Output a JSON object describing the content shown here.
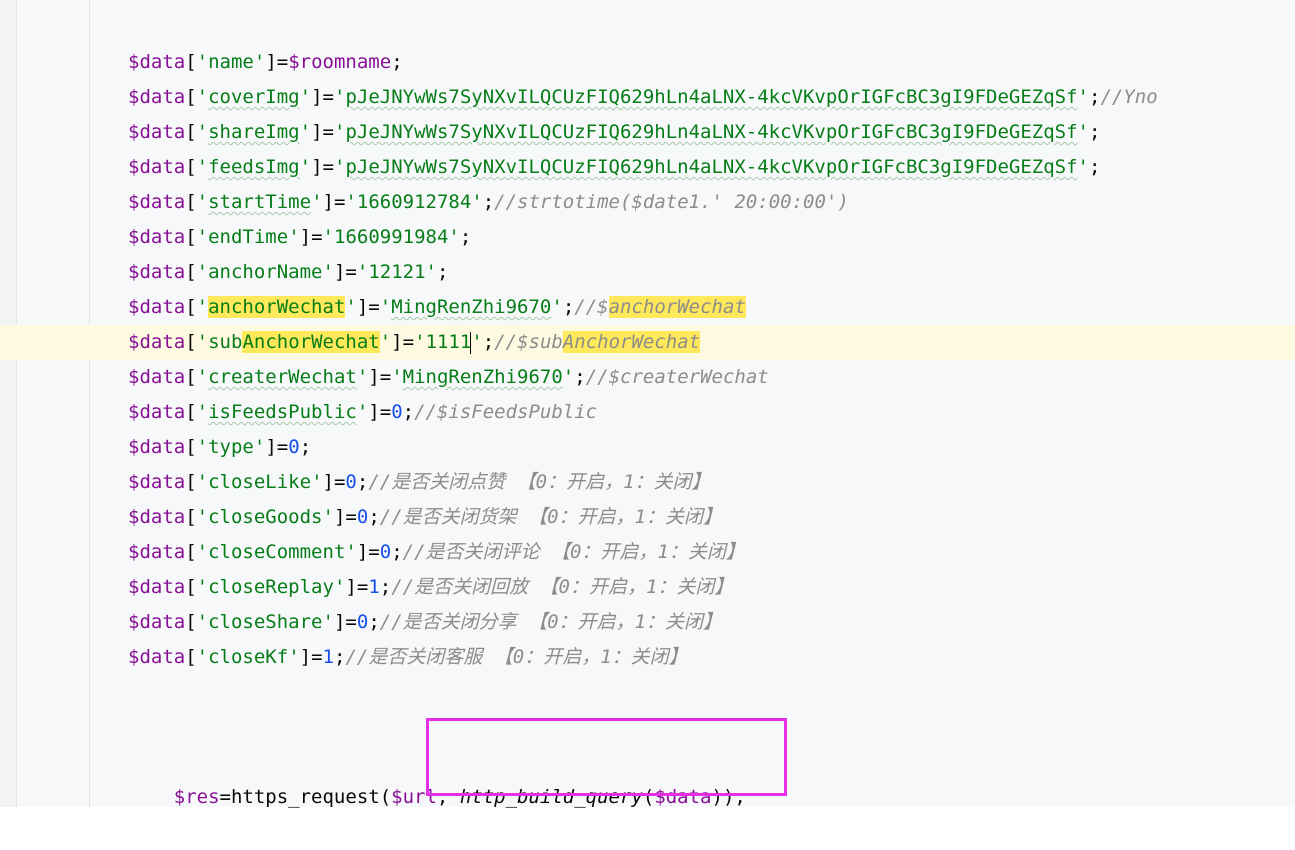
{
  "lines": [
    {
      "key": "name",
      "value_var": "$roomname",
      "sep": ";"
    },
    {
      "key": "coverImg",
      "value_str": "pJeJNYwWs7SyNXvILQCUzFIQ629hLn4aLNX-4kcVKvpOrIGFcBC3gI9FDeGEZqSf",
      "comment": "//Yno"
    },
    {
      "key": "shareImg",
      "value_str": "pJeJNYwWs7SyNXvILQCUzFIQ629hLn4aLNX-4kcVKvpOrIGFcBC3gI9FDeGEZqSf"
    },
    {
      "key": "feedsImg",
      "value_str": "pJeJNYwWs7SyNXvILQCUzFIQ629hLn4aLNX-4kcVKvpOrIGFcBC3gI9FDeGEZqSf"
    },
    {
      "key": "startTime",
      "value_str": "1660912784",
      "comment": "//strtotime($date1.' 20:00:00')"
    },
    {
      "key": "endTime",
      "value_str": "1660991984"
    },
    {
      "key": "anchorName",
      "value_str": "12121"
    },
    {
      "key": "anchorWechat",
      "value_str": "MingRenZhi9670",
      "comment_prefix": "//$",
      "comment_hl": "anchorWechat"
    },
    {
      "key_prefix": "sub",
      "key_hl": "AnchorWechat",
      "value_str": "1111",
      "comment_prefix": "//$sub",
      "comment_hl": "AnchorWechat"
    },
    {
      "key": "createrWechat",
      "value_str": "MingRenZhi9670",
      "comment": "//$createrWechat"
    },
    {
      "key": "isFeedsPublic",
      "value_num": "0",
      "comment": "//$isFeedsPublic"
    },
    {
      "key": "type",
      "value_num": "0"
    },
    {
      "key": "closeLike",
      "value_num": "0",
      "comment": "//是否关闭点赞 【0：开启，1：关闭】"
    },
    {
      "key": "closeGoods",
      "value_num": "0",
      "comment": "//是否关闭货架 【0：开启，1：关闭】"
    },
    {
      "key": "closeComment",
      "value_num": "0",
      "comment": "//是否关闭评论 【0：开启，1：关闭】"
    },
    {
      "key": "closeReplay",
      "value_num": "1",
      "comment": "//是否关闭回放 【0：开启，1：关闭】"
    },
    {
      "key": "closeShare",
      "value_num": "0",
      "comment": "//是否关闭分享 【0：开启，1：关闭】"
    },
    {
      "key": "closeKf",
      "value_num": "1",
      "comment": "//是否关闭客服 【0：开启，1：关闭】"
    }
  ],
  "data_var": "$data",
  "last_line": {
    "res_var": "$res",
    "eq": "=",
    "fn": "https_request",
    "url_var": "$url",
    "comma": ", ",
    "inner_fn": "http_build_query",
    "data_arg": "$data",
    "close": "));"
  },
  "colors": {
    "annotation_box": "#e52fe6",
    "highlight": "#ffe859",
    "current_line": "#fefae2"
  }
}
